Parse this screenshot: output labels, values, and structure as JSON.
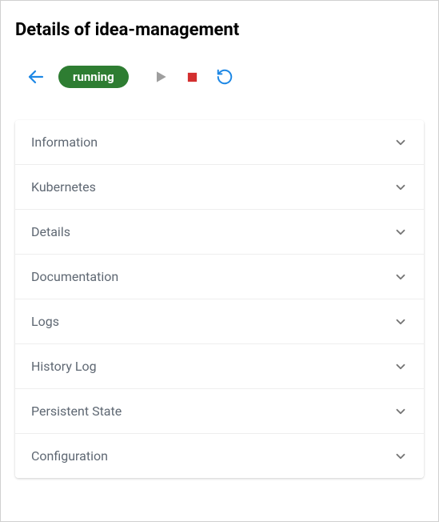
{
  "title": "Details of idea-management",
  "status": {
    "label": "running",
    "color": "#2e7d32"
  },
  "panels": [
    {
      "label": "Information"
    },
    {
      "label": "Kubernetes"
    },
    {
      "label": "Details"
    },
    {
      "label": "Documentation"
    },
    {
      "label": "Logs"
    },
    {
      "label": "History Log"
    },
    {
      "label": "Persistent State"
    },
    {
      "label": "Configuration"
    }
  ]
}
